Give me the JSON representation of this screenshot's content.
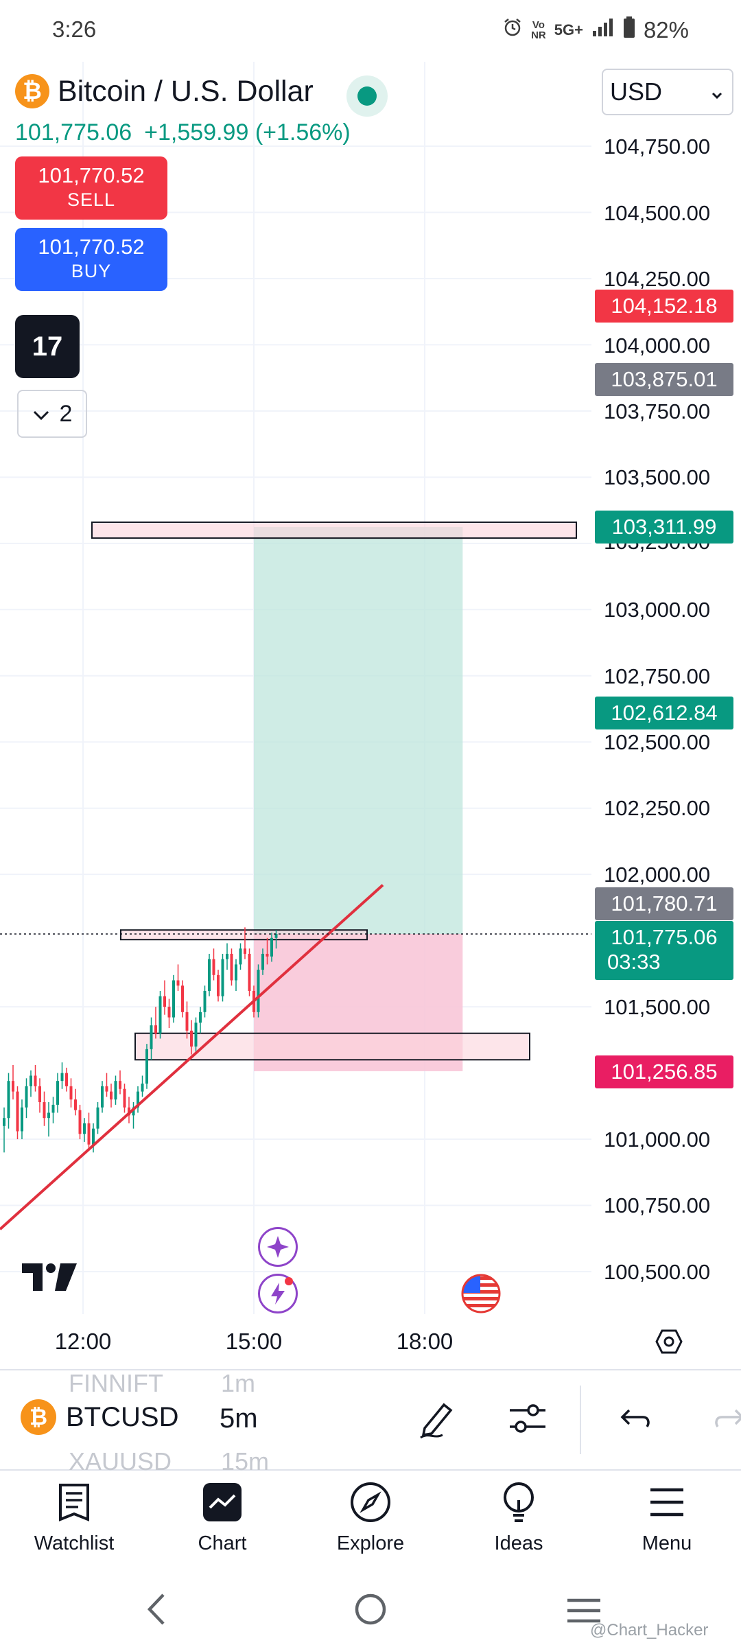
{
  "status_bar": {
    "time": "3:26",
    "network_small": "Vo\nNR",
    "network": "5G+",
    "battery": "82%"
  },
  "header": {
    "symbol_logo": "₿",
    "symbol_title": "Bitcoin / U.S. Dollar",
    "last_price": "101,775.06",
    "change": "+1,559.99 (+1.56%)",
    "currency": "USD"
  },
  "trade": {
    "sell_price": "101,770.52",
    "sell_label": "SELL",
    "buy_price": "101,770.52",
    "buy_label": "BUY"
  },
  "indicators": {
    "logo_text": "17",
    "collapsed_count": "2"
  },
  "price_axis": {
    "labels": [
      "104,750.00",
      "104,500.00",
      "104,250.00",
      "104,000.00",
      "103,750.00",
      "103,500.00",
      "103,250.00",
      "103,000.00",
      "102,750.00",
      "102,500.00",
      "102,250.00",
      "102,000.00",
      "101,500.00",
      "101,000.00",
      "100,750.00",
      "100,500.00"
    ],
    "badges": {
      "red_top": "104,152.18",
      "gray_top": "103,875.01",
      "green_target": "103,311.99",
      "green_mid": "102,612.84",
      "gray_bottom": "101,780.71",
      "current_price": "101,775.06",
      "countdown": "03:33",
      "stop": "101,256.85"
    }
  },
  "time_axis": {
    "labels": [
      "12:00",
      "15:00",
      "18:00"
    ]
  },
  "toolbar": {
    "symbol": "BTCUSD",
    "interval": "5m",
    "ghost_symbol_above": "FINNIFT",
    "ghost_interval_above": "1m",
    "ghost_symbol_below": "XAUUSD",
    "ghost_interval_below": "15m"
  },
  "bottom_nav": [
    {
      "label": "Watchlist"
    },
    {
      "label": "Chart"
    },
    {
      "label": "Explore"
    },
    {
      "label": "Ideas"
    },
    {
      "label": "Menu"
    }
  ],
  "watermark": "@Chart_Hacker",
  "colors": {
    "up": "#089981",
    "down": "#f23645",
    "buy": "#2962ff",
    "target_zone": "#bfe6dc",
    "stop_zone": "#f8c3d6",
    "trend_line": "#e0303e"
  },
  "chart_data": {
    "type": "candlestick",
    "symbol": "BTCUSD",
    "interval": "5m",
    "y_range": [
      100400,
      104900
    ],
    "position": {
      "entry": 101775.06,
      "target": 103311.99,
      "stop": 101256.85
    },
    "zones": [
      {
        "top": 103330,
        "bottom": 103270
      },
      {
        "top": 101790,
        "bottom": 101755
      },
      {
        "top": 101400,
        "bottom": 101300
      }
    ],
    "trendline": [
      {
        "t": "10:00",
        "price": 100660
      },
      {
        "t": "16:45",
        "price": 101960
      }
    ],
    "candles": [
      [
        101050,
        101120,
        100950,
        101080
      ],
      [
        101080,
        101250,
        101040,
        101220
      ],
      [
        101220,
        101280,
        101150,
        101180
      ],
      [
        101180,
        101200,
        101000,
        101030
      ],
      [
        101030,
        101150,
        101000,
        101120
      ],
      [
        101120,
        101230,
        101080,
        101200
      ],
      [
        101200,
        101260,
        101160,
        101240
      ],
      [
        101240,
        101280,
        101180,
        101200
      ],
      [
        101200,
        101230,
        101100,
        101140
      ],
      [
        101140,
        101180,
        101050,
        101080
      ],
      [
        101080,
        101140,
        101010,
        101100
      ],
      [
        101100,
        101160,
        101060,
        101130
      ],
      [
        101130,
        101250,
        101100,
        101220
      ],
      [
        101220,
        101290,
        101190,
        101250
      ],
      [
        101250,
        101270,
        101180,
        101200
      ],
      [
        101200,
        101230,
        101120,
        101150
      ],
      [
        101150,
        101190,
        101090,
        101110
      ],
      [
        101110,
        101130,
        101000,
        101020
      ],
      [
        101020,
        101080,
        100990,
        101060
      ],
      [
        101060,
        101100,
        100960,
        100980
      ],
      [
        100980,
        101060,
        100950,
        101040
      ],
      [
        101040,
        101140,
        101020,
        101120
      ],
      [
        101120,
        101220,
        101100,
        101200
      ],
      [
        101200,
        101250,
        101160,
        101180
      ],
      [
        101180,
        101210,
        101120,
        101150
      ],
      [
        101150,
        101240,
        101130,
        101220
      ],
      [
        101220,
        101260,
        101170,
        101190
      ],
      [
        101190,
        101210,
        101100,
        101120
      ],
      [
        101120,
        101160,
        101060,
        101090
      ],
      [
        101090,
        101140,
        101040,
        101120
      ],
      [
        101120,
        101200,
        101100,
        101180
      ],
      [
        101180,
        101240,
        101160,
        101210
      ],
      [
        101210,
        101360,
        101190,
        101340
      ],
      [
        101340,
        101460,
        101300,
        101430
      ],
      [
        101430,
        101500,
        101380,
        101400
      ],
      [
        101400,
        101560,
        101380,
        101540
      ],
      [
        101540,
        101600,
        101470,
        101500
      ],
      [
        101500,
        101530,
        101420,
        101460
      ],
      [
        101460,
        101620,
        101440,
        101600
      ],
      [
        101600,
        101660,
        101560,
        101580
      ],
      [
        101580,
        101600,
        101460,
        101480
      ],
      [
        101480,
        101520,
        101380,
        101410
      ],
      [
        101410,
        101450,
        101320,
        101350
      ],
      [
        101350,
        101460,
        101330,
        101440
      ],
      [
        101440,
        101500,
        101400,
        101480
      ],
      [
        101480,
        101580,
        101460,
        101560
      ],
      [
        101560,
        101700,
        101540,
        101680
      ],
      [
        101680,
        101720,
        101600,
        101620
      ],
      [
        101620,
        101640,
        101520,
        101540
      ],
      [
        101540,
        101700,
        101520,
        101680
      ],
      [
        101680,
        101740,
        101640,
        101700
      ],
      [
        101700,
        101720,
        101580,
        101600
      ],
      [
        101600,
        101680,
        101560,
        101660
      ],
      [
        101660,
        101740,
        101640,
        101720
      ],
      [
        101720,
        101800,
        101680,
        101700
      ],
      [
        101700,
        101720,
        101540,
        101560
      ],
      [
        101560,
        101580,
        101460,
        101480
      ],
      [
        101480,
        101660,
        101460,
        101640
      ],
      [
        101640,
        101720,
        101620,
        101700
      ],
      [
        101700,
        101760,
        101660,
        101690
      ],
      [
        101690,
        101780,
        101670,
        101760
      ],
      [
        101760,
        101790,
        101720,
        101775
      ]
    ]
  }
}
